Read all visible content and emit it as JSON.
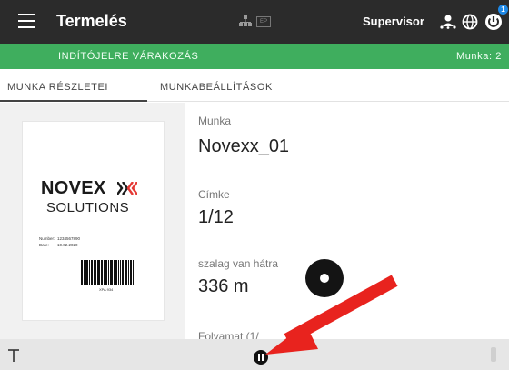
{
  "topbar": {
    "title": "Termelés",
    "ep_label": "EP",
    "user": "Supervisor",
    "notification_count": "1",
    "icons": [
      "menu-icon",
      "network-icon",
      "ep-icon",
      "user-icon",
      "globe-icon",
      "power-icon"
    ]
  },
  "status": {
    "text": "INDÍTÓJELRE VÁRAKOZÁS",
    "job_count": "Munka: 2",
    "color": "#3fae5e"
  },
  "tabs": [
    {
      "label": "MUNKA RÉSZLETEI",
      "active": true
    },
    {
      "label": "MUNKABEÁLLÍTÁSOK",
      "active": false
    }
  ],
  "label_preview": {
    "logo_main": "NOVEX",
    "logo_sub": "SOLUTIONS",
    "rows": [
      {
        "key": "Number:",
        "value": "1234567890"
      },
      {
        "key": "Date:",
        "value": "10.02.2020"
      }
    ],
    "barcode_text": "XPA 934"
  },
  "details": {
    "job_label": "Munka",
    "job_value": "Novexx_01",
    "label_label": "Címke",
    "label_value": "1/12",
    "ribbon_label": "szalag van hátra",
    "ribbon_value": "336 m",
    "progress_label": "Folyamat (1/"
  },
  "colors": {
    "topbar": "#2b2b2b",
    "status_green": "#3fae5e",
    "arrow_red": "#e8231e"
  }
}
